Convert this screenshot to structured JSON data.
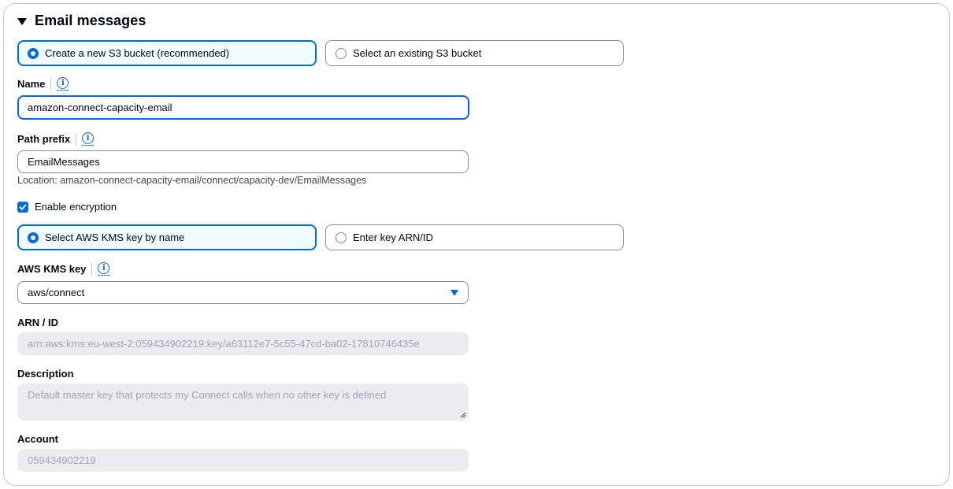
{
  "section": {
    "title": "Email messages"
  },
  "storage_choice": {
    "options": [
      {
        "label": "Create a new S3 bucket (recommended)",
        "selected": true
      },
      {
        "label": "Select an existing S3 bucket",
        "selected": false
      }
    ]
  },
  "name_field": {
    "label": "Name",
    "value": "amazon-connect-capacity-email"
  },
  "path_prefix_field": {
    "label": "Path prefix",
    "value": "EmailMessages",
    "location_hint": "Location: amazon-connect-capacity-email/connect/capacity-dev/EmailMessages"
  },
  "encryption": {
    "label": "Enable encryption",
    "checked": true
  },
  "kms_choice": {
    "options": [
      {
        "label": "Select AWS KMS key by name",
        "selected": true
      },
      {
        "label": "Enter key ARN/ID",
        "selected": false
      }
    ]
  },
  "kms_key_field": {
    "label": "AWS KMS key",
    "value": "aws/connect"
  },
  "arn_field": {
    "label": "ARN / ID",
    "value": "arn:aws:kms:eu-west-2:059434902219:key/a63112e7-5c55-47cd-ba02-17810746435e"
  },
  "description_field": {
    "label": "Description",
    "value": "Default master key that protects my Connect calls when no other key is defined"
  },
  "account_field": {
    "label": "Account",
    "value": "059434902219"
  },
  "icons": {
    "info": "i"
  },
  "colors": {
    "accent": "#006ce0",
    "selected_tile_bg": "#f0fbff",
    "disabled_bg": "#ebebf0"
  }
}
